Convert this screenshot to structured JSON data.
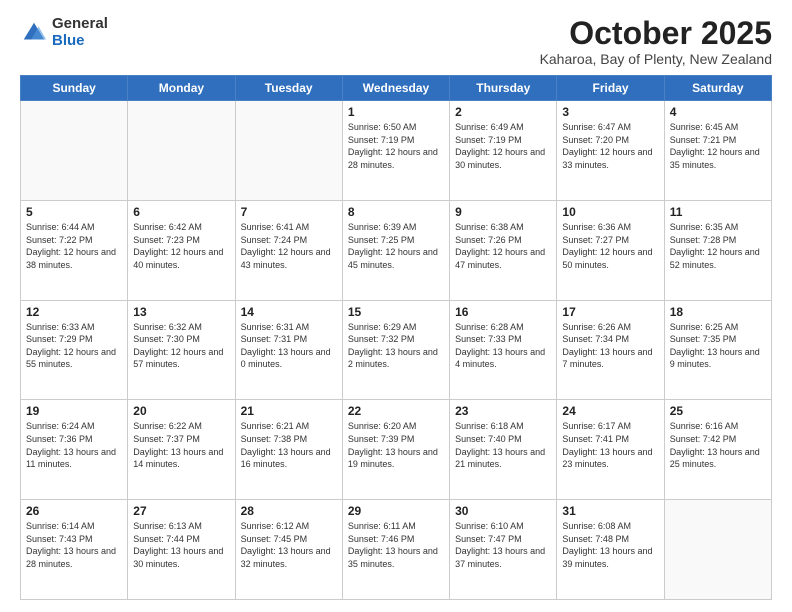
{
  "logo": {
    "general": "General",
    "blue": "Blue"
  },
  "header": {
    "month": "October 2025",
    "location": "Kaharoa, Bay of Plenty, New Zealand"
  },
  "weekdays": [
    "Sunday",
    "Monday",
    "Tuesday",
    "Wednesday",
    "Thursday",
    "Friday",
    "Saturday"
  ],
  "weeks": [
    [
      {
        "day": "",
        "sunrise": "",
        "sunset": "",
        "daylight": ""
      },
      {
        "day": "",
        "sunrise": "",
        "sunset": "",
        "daylight": ""
      },
      {
        "day": "",
        "sunrise": "",
        "sunset": "",
        "daylight": ""
      },
      {
        "day": "1",
        "sunrise": "Sunrise: 6:50 AM",
        "sunset": "Sunset: 7:19 PM",
        "daylight": "Daylight: 12 hours and 28 minutes."
      },
      {
        "day": "2",
        "sunrise": "Sunrise: 6:49 AM",
        "sunset": "Sunset: 7:19 PM",
        "daylight": "Daylight: 12 hours and 30 minutes."
      },
      {
        "day": "3",
        "sunrise": "Sunrise: 6:47 AM",
        "sunset": "Sunset: 7:20 PM",
        "daylight": "Daylight: 12 hours and 33 minutes."
      },
      {
        "day": "4",
        "sunrise": "Sunrise: 6:45 AM",
        "sunset": "Sunset: 7:21 PM",
        "daylight": "Daylight: 12 hours and 35 minutes."
      }
    ],
    [
      {
        "day": "5",
        "sunrise": "Sunrise: 6:44 AM",
        "sunset": "Sunset: 7:22 PM",
        "daylight": "Daylight: 12 hours and 38 minutes."
      },
      {
        "day": "6",
        "sunrise": "Sunrise: 6:42 AM",
        "sunset": "Sunset: 7:23 PM",
        "daylight": "Daylight: 12 hours and 40 minutes."
      },
      {
        "day": "7",
        "sunrise": "Sunrise: 6:41 AM",
        "sunset": "Sunset: 7:24 PM",
        "daylight": "Daylight: 12 hours and 43 minutes."
      },
      {
        "day": "8",
        "sunrise": "Sunrise: 6:39 AM",
        "sunset": "Sunset: 7:25 PM",
        "daylight": "Daylight: 12 hours and 45 minutes."
      },
      {
        "day": "9",
        "sunrise": "Sunrise: 6:38 AM",
        "sunset": "Sunset: 7:26 PM",
        "daylight": "Daylight: 12 hours and 47 minutes."
      },
      {
        "day": "10",
        "sunrise": "Sunrise: 6:36 AM",
        "sunset": "Sunset: 7:27 PM",
        "daylight": "Daylight: 12 hours and 50 minutes."
      },
      {
        "day": "11",
        "sunrise": "Sunrise: 6:35 AM",
        "sunset": "Sunset: 7:28 PM",
        "daylight": "Daylight: 12 hours and 52 minutes."
      }
    ],
    [
      {
        "day": "12",
        "sunrise": "Sunrise: 6:33 AM",
        "sunset": "Sunset: 7:29 PM",
        "daylight": "Daylight: 12 hours and 55 minutes."
      },
      {
        "day": "13",
        "sunrise": "Sunrise: 6:32 AM",
        "sunset": "Sunset: 7:30 PM",
        "daylight": "Daylight: 12 hours and 57 minutes."
      },
      {
        "day": "14",
        "sunrise": "Sunrise: 6:31 AM",
        "sunset": "Sunset: 7:31 PM",
        "daylight": "Daylight: 13 hours and 0 minutes."
      },
      {
        "day": "15",
        "sunrise": "Sunrise: 6:29 AM",
        "sunset": "Sunset: 7:32 PM",
        "daylight": "Daylight: 13 hours and 2 minutes."
      },
      {
        "day": "16",
        "sunrise": "Sunrise: 6:28 AM",
        "sunset": "Sunset: 7:33 PM",
        "daylight": "Daylight: 13 hours and 4 minutes."
      },
      {
        "day": "17",
        "sunrise": "Sunrise: 6:26 AM",
        "sunset": "Sunset: 7:34 PM",
        "daylight": "Daylight: 13 hours and 7 minutes."
      },
      {
        "day": "18",
        "sunrise": "Sunrise: 6:25 AM",
        "sunset": "Sunset: 7:35 PM",
        "daylight": "Daylight: 13 hours and 9 minutes."
      }
    ],
    [
      {
        "day": "19",
        "sunrise": "Sunrise: 6:24 AM",
        "sunset": "Sunset: 7:36 PM",
        "daylight": "Daylight: 13 hours and 11 minutes."
      },
      {
        "day": "20",
        "sunrise": "Sunrise: 6:22 AM",
        "sunset": "Sunset: 7:37 PM",
        "daylight": "Daylight: 13 hours and 14 minutes."
      },
      {
        "day": "21",
        "sunrise": "Sunrise: 6:21 AM",
        "sunset": "Sunset: 7:38 PM",
        "daylight": "Daylight: 13 hours and 16 minutes."
      },
      {
        "day": "22",
        "sunrise": "Sunrise: 6:20 AM",
        "sunset": "Sunset: 7:39 PM",
        "daylight": "Daylight: 13 hours and 19 minutes."
      },
      {
        "day": "23",
        "sunrise": "Sunrise: 6:18 AM",
        "sunset": "Sunset: 7:40 PM",
        "daylight": "Daylight: 13 hours and 21 minutes."
      },
      {
        "day": "24",
        "sunrise": "Sunrise: 6:17 AM",
        "sunset": "Sunset: 7:41 PM",
        "daylight": "Daylight: 13 hours and 23 minutes."
      },
      {
        "day": "25",
        "sunrise": "Sunrise: 6:16 AM",
        "sunset": "Sunset: 7:42 PM",
        "daylight": "Daylight: 13 hours and 25 minutes."
      }
    ],
    [
      {
        "day": "26",
        "sunrise": "Sunrise: 6:14 AM",
        "sunset": "Sunset: 7:43 PM",
        "daylight": "Daylight: 13 hours and 28 minutes."
      },
      {
        "day": "27",
        "sunrise": "Sunrise: 6:13 AM",
        "sunset": "Sunset: 7:44 PM",
        "daylight": "Daylight: 13 hours and 30 minutes."
      },
      {
        "day": "28",
        "sunrise": "Sunrise: 6:12 AM",
        "sunset": "Sunset: 7:45 PM",
        "daylight": "Daylight: 13 hours and 32 minutes."
      },
      {
        "day": "29",
        "sunrise": "Sunrise: 6:11 AM",
        "sunset": "Sunset: 7:46 PM",
        "daylight": "Daylight: 13 hours and 35 minutes."
      },
      {
        "day": "30",
        "sunrise": "Sunrise: 6:10 AM",
        "sunset": "Sunset: 7:47 PM",
        "daylight": "Daylight: 13 hours and 37 minutes."
      },
      {
        "day": "31",
        "sunrise": "Sunrise: 6:08 AM",
        "sunset": "Sunset: 7:48 PM",
        "daylight": "Daylight: 13 hours and 39 minutes."
      },
      {
        "day": "",
        "sunrise": "",
        "sunset": "",
        "daylight": ""
      }
    ]
  ]
}
